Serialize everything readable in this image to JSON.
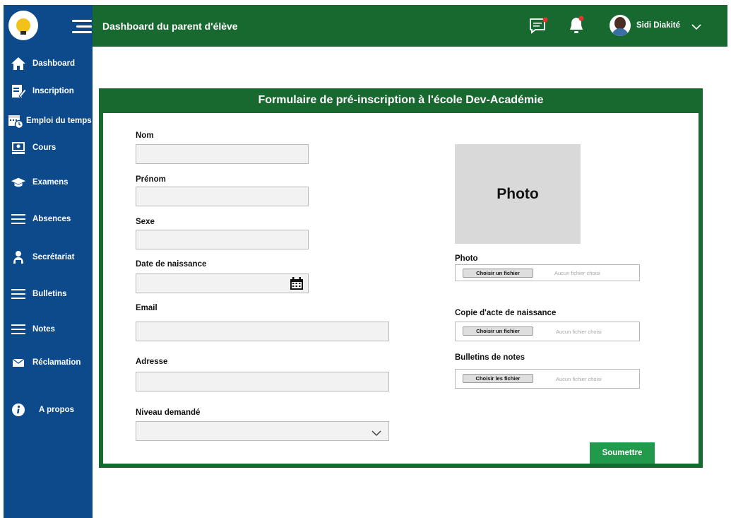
{
  "header": {
    "title": "Dashboard du parent d'élève",
    "user_name": "Sidi Diakité",
    "icons": [
      "chat-icon",
      "bell-icon",
      "chevron-down-icon"
    ],
    "accent_color": "#17692f"
  },
  "sidebar": {
    "color": "#0d4a8c",
    "items": [
      {
        "label": "Dashboard",
        "icon": "home-icon"
      },
      {
        "label": "Inscription",
        "icon": "edit-form-icon"
      },
      {
        "label": "Emploi du temps",
        "icon": "schedule-icon"
      },
      {
        "label": "Cours",
        "icon": "book-icon"
      },
      {
        "label": "Examens",
        "icon": "graduation-cap-icon"
      },
      {
        "label": "Absences",
        "icon": "menu-icon"
      },
      {
        "label": "Secrétariat",
        "icon": "secretary-icon"
      },
      {
        "label": "Bulletins",
        "icon": "menu-icon"
      },
      {
        "label": "Notes",
        "icon": "menu-icon"
      },
      {
        "label": "Réclamation",
        "icon": "mail-icon"
      },
      {
        "label": "A propos",
        "icon": "info-icon"
      }
    ]
  },
  "form": {
    "title": "Formulaire de pré-inscription à l'école Dev-Académie",
    "fields": {
      "nom": {
        "label": "Nom",
        "value": ""
      },
      "prenom": {
        "label": "Prénom",
        "value": ""
      },
      "sexe": {
        "label": "Sexe",
        "value": ""
      },
      "date_naissance": {
        "label": "Date de naissance",
        "value": ""
      },
      "email": {
        "label": "Email",
        "value": ""
      },
      "adresse": {
        "label": "Adresse",
        "value": ""
      },
      "niveau": {
        "label": "Niveau demandé",
        "value": ""
      }
    },
    "photo_placeholder": "Photo",
    "uploads": [
      {
        "label": "Photo",
        "button": "Choisir un fichier",
        "status": "Aucun fichier choisi"
      },
      {
        "label": "Copie d'acte de naissance",
        "button": "Choisir un fichier",
        "status": "Aucun fichier choisi"
      },
      {
        "label": "Bulletins de notes",
        "button": "Choisir les fichier",
        "status": "Aucun fichier choisi"
      }
    ],
    "submit_label": "Soumettre"
  }
}
